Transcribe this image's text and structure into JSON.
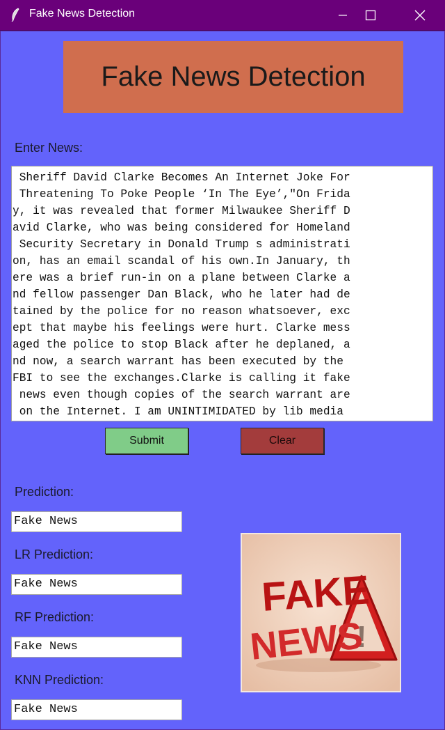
{
  "window": {
    "title": "Fake News Detection"
  },
  "header": {
    "title": "Fake News Detection"
  },
  "news": {
    "label": "Enter News:",
    "lines": [
      " Sheriff David Clarke Becomes An Internet Joke For",
      " Threatening To Poke People ‘In The Eye’,\"On Frida",
      "y, it was revealed that former Milwaukee Sheriff D",
      "avid Clarke, who was being considered for Homeland",
      " Security Secretary in Donald Trump s administrati",
      "on, has an email scandal of his own.In January, th",
      "ere was a brief run-in on a plane between Clarke a",
      "nd fellow passenger Dan Black, who he later had de",
      "tained by the police for no reason whatsoever, exc",
      "ept that maybe his feelings were hurt. Clarke mess",
      "aged the police to stop Black after he deplaned, a",
      "nd now, a search warrant has been executed by the ",
      "FBI to see the exchanges.Clarke is calling it fake",
      " news even though copies of the search warrant are",
      " on the Internet. I am UNINTIMIDATED by lib media "
    ]
  },
  "buttons": {
    "submit": "Submit",
    "clear": "Clear"
  },
  "predictions": {
    "main_label": "Prediction:",
    "main_value": "Fake News",
    "lr_label": "LR Prediction:",
    "lr_value": "Fake News",
    "rf_label": "RF Prediction:",
    "rf_value": "Fake News",
    "knn_label": "KNN Prediction:",
    "knn_value": "Fake News"
  },
  "image": {
    "word1": "FAKE",
    "word2": "NEWS",
    "warning_symbol": "!"
  },
  "colors": {
    "background": "#6363fb",
    "titlebar": "#6a007a",
    "header": "#d06e4e",
    "submit": "#80cc88",
    "clear": "#a33c3c"
  }
}
